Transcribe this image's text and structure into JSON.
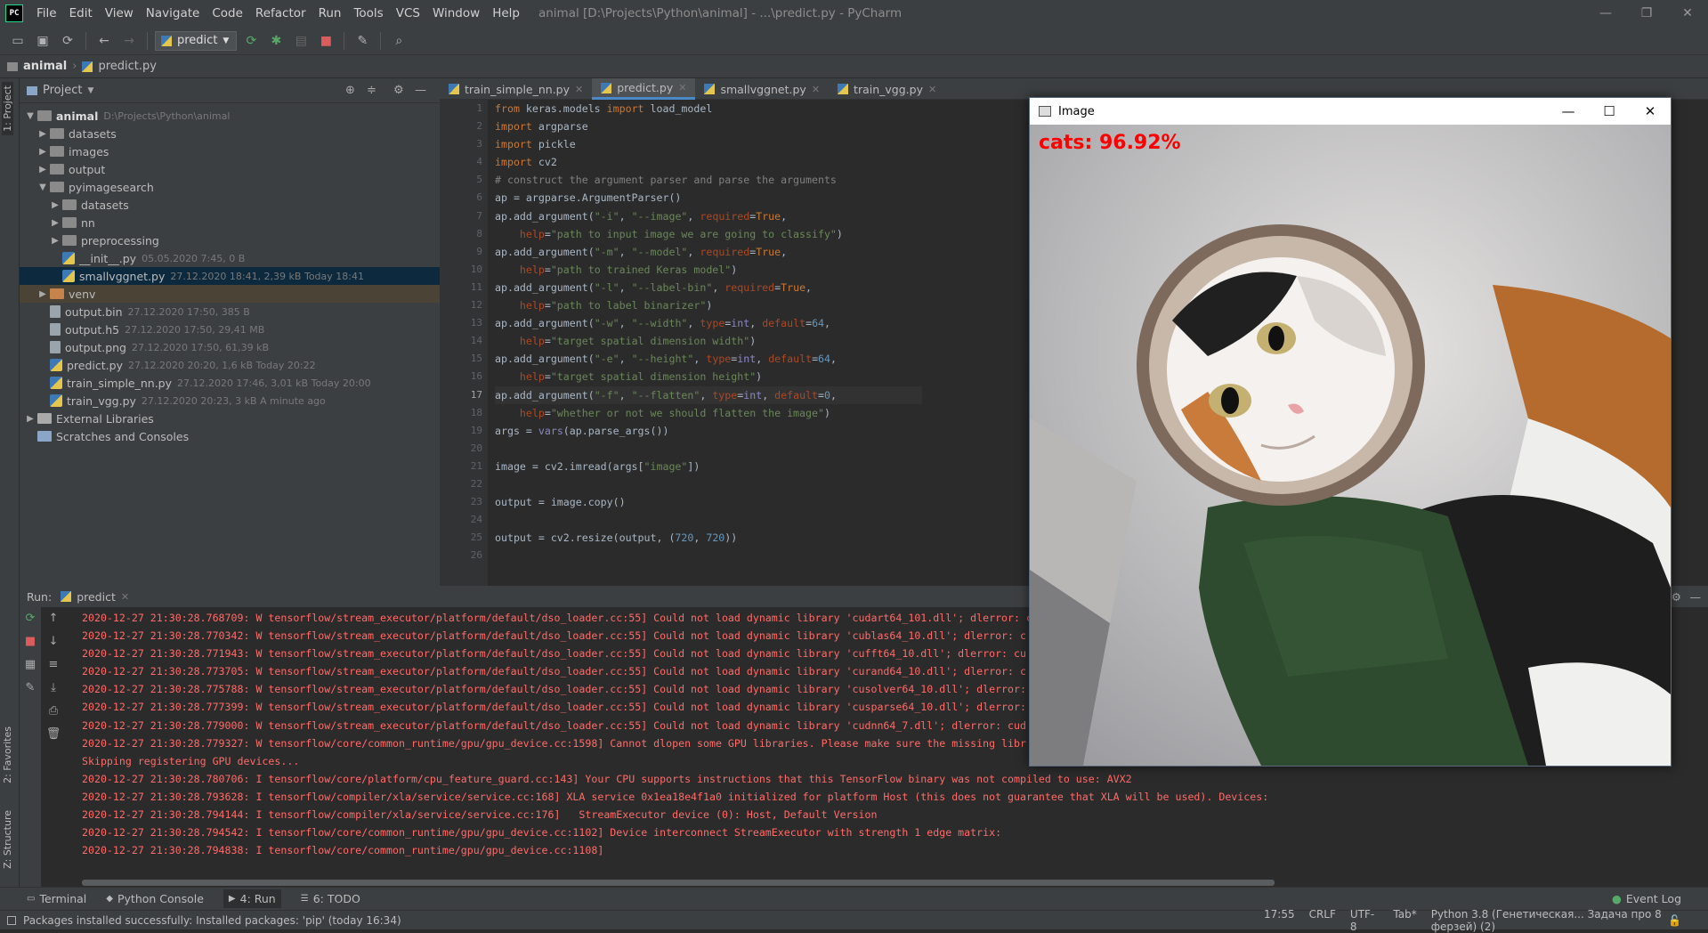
{
  "app": {
    "title": "animal [D:\\Projects\\Python\\animal] - ...\\predict.py - PyCharm",
    "menu": [
      "File",
      "Edit",
      "View",
      "Navigate",
      "Code",
      "Refactor",
      "Run",
      "Tools",
      "VCS",
      "Window",
      "Help"
    ]
  },
  "toolbar": {
    "run_config": "predict"
  },
  "breadcrumb": {
    "project": "animal",
    "file": "predict.py"
  },
  "left_strip": {
    "project": "1: Project",
    "favorites": "2: Favorites",
    "structure": "Z: Structure"
  },
  "project_panel": {
    "title": "Project",
    "tree": [
      {
        "indent": 0,
        "arrow": "▼",
        "icon": "folder",
        "name": "animal",
        "meta": "D:\\Projects\\Python\\animal",
        "bold": true
      },
      {
        "indent": 1,
        "arrow": "▶",
        "icon": "folder",
        "name": "datasets",
        "meta": ""
      },
      {
        "indent": 1,
        "arrow": "▶",
        "icon": "folder",
        "name": "images",
        "meta": ""
      },
      {
        "indent": 1,
        "arrow": "▶",
        "icon": "folder",
        "name": "output",
        "meta": ""
      },
      {
        "indent": 1,
        "arrow": "▼",
        "icon": "folder",
        "name": "pyimagesearch",
        "meta": ""
      },
      {
        "indent": 2,
        "arrow": "▶",
        "icon": "folder",
        "name": "datasets",
        "meta": ""
      },
      {
        "indent": 2,
        "arrow": "▶",
        "icon": "folder",
        "name": "nn",
        "meta": ""
      },
      {
        "indent": 2,
        "arrow": "▶",
        "icon": "folder",
        "name": "preprocessing",
        "meta": ""
      },
      {
        "indent": 2,
        "arrow": "",
        "icon": "py",
        "name": "__init__.py",
        "meta": "05.05.2020 7:45, 0 B"
      },
      {
        "indent": 2,
        "arrow": "",
        "icon": "py",
        "name": "smallvggnet.py",
        "meta": "27.12.2020 18:41, 2,39 kB Today 18:41",
        "selected": true
      },
      {
        "indent": 1,
        "arrow": "▶",
        "icon": "folder-orange",
        "name": "venv",
        "meta": "",
        "venv": true
      },
      {
        "indent": 1,
        "arrow": "",
        "icon": "file",
        "name": "output.bin",
        "meta": "27.12.2020 17:50, 385 B"
      },
      {
        "indent": 1,
        "arrow": "",
        "icon": "file",
        "name": "output.h5",
        "meta": "27.12.2020 17:50, 29,41 MB"
      },
      {
        "indent": 1,
        "arrow": "",
        "icon": "file",
        "name": "output.png",
        "meta": "27.12.2020 17:50, 61,39 kB"
      },
      {
        "indent": 1,
        "arrow": "",
        "icon": "py",
        "name": "predict.py",
        "meta": "27.12.2020 20:20, 1,6 kB Today 20:22"
      },
      {
        "indent": 1,
        "arrow": "",
        "icon": "py",
        "name": "train_simple_nn.py",
        "meta": "27.12.2020 17:46, 3,01 kB Today 20:00"
      },
      {
        "indent": 1,
        "arrow": "",
        "icon": "py",
        "name": "train_vgg.py",
        "meta": "27.12.2020 20:23, 3 kB A minute ago"
      },
      {
        "indent": 0,
        "arrow": "▶",
        "icon": "lib",
        "name": "External Libraries",
        "meta": ""
      },
      {
        "indent": 0,
        "arrow": "",
        "icon": "scratch",
        "name": "Scratches and Consoles",
        "meta": ""
      }
    ]
  },
  "editor": {
    "tabs": [
      {
        "label": "train_simple_nn.py",
        "active": false
      },
      {
        "label": "predict.py",
        "active": true
      },
      {
        "label": "smallvggnet.py",
        "active": false
      },
      {
        "label": "train_vgg.py",
        "active": false
      }
    ],
    "line_numbers": [
      "1",
      "2",
      "3",
      "4",
      "5",
      "6",
      "7",
      "8",
      "9",
      "10",
      "11",
      "12",
      "13",
      "14",
      "15",
      "16",
      "17",
      "18",
      "19",
      "20",
      "21",
      "22",
      "23",
      "24",
      "25",
      "26"
    ],
    "lines": [
      [
        [
          "kw",
          "from "
        ],
        [
          "",
          "keras.models "
        ],
        [
          "kw",
          "import "
        ],
        [
          "",
          "load_model"
        ]
      ],
      [
        [
          "kw",
          "import "
        ],
        [
          "",
          "argparse"
        ]
      ],
      [
        [
          "kw",
          "import "
        ],
        [
          "",
          "pickle"
        ]
      ],
      [
        [
          "kw",
          "import "
        ],
        [
          "",
          "cv2"
        ]
      ],
      [
        [
          "cm",
          "# construct the argument parser and parse the arguments"
        ]
      ],
      [
        [
          "",
          "ap = argparse.ArgumentParser()"
        ]
      ],
      [
        [
          "",
          "ap.add_argument("
        ],
        [
          "st",
          "\"-i\""
        ],
        [
          "",
          ", "
        ],
        [
          "st",
          "\"--image\""
        ],
        [
          "",
          ", "
        ],
        [
          "pa",
          "required"
        ],
        [
          "",
          "="
        ],
        [
          "kw",
          "True"
        ],
        [
          "",
          ","
        ]
      ],
      [
        [
          "",
          "    "
        ],
        [
          "pa",
          "help"
        ],
        [
          "",
          "="
        ],
        [
          "st",
          "\"path to input image we are going to classify\""
        ],
        [
          "",
          ")"
        ]
      ],
      [
        [
          "",
          "ap.add_argument("
        ],
        [
          "st",
          "\"-m\""
        ],
        [
          "",
          ", "
        ],
        [
          "st",
          "\"--model\""
        ],
        [
          "",
          ", "
        ],
        [
          "pa",
          "required"
        ],
        [
          "",
          "="
        ],
        [
          "kw",
          "True"
        ],
        [
          "",
          ","
        ]
      ],
      [
        [
          "",
          "    "
        ],
        [
          "pa",
          "help"
        ],
        [
          "",
          "="
        ],
        [
          "st",
          "\"path to trained Keras model\""
        ],
        [
          "",
          ")"
        ]
      ],
      [
        [
          "",
          "ap.add_argument("
        ],
        [
          "st",
          "\"-l\""
        ],
        [
          "",
          ", "
        ],
        [
          "st",
          "\"--label-bin\""
        ],
        [
          "",
          ", "
        ],
        [
          "pa",
          "required"
        ],
        [
          "",
          "="
        ],
        [
          "kw",
          "True"
        ],
        [
          "",
          ","
        ]
      ],
      [
        [
          "",
          "    "
        ],
        [
          "pa",
          "help"
        ],
        [
          "",
          "="
        ],
        [
          "st",
          "\"path to label binarizer\""
        ],
        [
          "",
          ")"
        ]
      ],
      [
        [
          "",
          "ap.add_argument("
        ],
        [
          "st",
          "\"-w\""
        ],
        [
          "",
          ", "
        ],
        [
          "st",
          "\"--width\""
        ],
        [
          "",
          ", "
        ],
        [
          "pa",
          "type"
        ],
        [
          "",
          "="
        ],
        [
          "bi",
          "int"
        ],
        [
          "",
          ", "
        ],
        [
          "pa",
          "default"
        ],
        [
          "",
          "="
        ],
        [
          "nu",
          "64"
        ],
        [
          "",
          ","
        ]
      ],
      [
        [
          "",
          "    "
        ],
        [
          "pa",
          "help"
        ],
        [
          "",
          "="
        ],
        [
          "st",
          "\"target spatial dimension width\""
        ],
        [
          "",
          ")"
        ]
      ],
      [
        [
          "",
          "ap.add_argument("
        ],
        [
          "st",
          "\"-e\""
        ],
        [
          "",
          ", "
        ],
        [
          "st",
          "\"--height\""
        ],
        [
          "",
          ", "
        ],
        [
          "pa",
          "type"
        ],
        [
          "",
          "="
        ],
        [
          "bi",
          "int"
        ],
        [
          "",
          ", "
        ],
        [
          "pa",
          "default"
        ],
        [
          "",
          "="
        ],
        [
          "nu",
          "64"
        ],
        [
          "",
          ","
        ]
      ],
      [
        [
          "",
          "    "
        ],
        [
          "pa",
          "help"
        ],
        [
          "",
          "="
        ],
        [
          "st",
          "\"target spatial dimension height\""
        ],
        [
          "",
          ")"
        ]
      ],
      [
        [
          "",
          "ap.add_argument("
        ],
        [
          "st",
          "\"-f\""
        ],
        [
          "",
          ", "
        ],
        [
          "st",
          "\"--flatten\""
        ],
        [
          "",
          ", "
        ],
        [
          "pa",
          "type"
        ],
        [
          "",
          "="
        ],
        [
          "bi",
          "int"
        ],
        [
          "",
          ", "
        ],
        [
          "pa",
          "default"
        ],
        [
          "",
          "="
        ],
        [
          "nu",
          "0"
        ],
        [
          "",
          ","
        ]
      ],
      [
        [
          "",
          "    "
        ],
        [
          "pa",
          "help"
        ],
        [
          "",
          "="
        ],
        [
          "st",
          "\"whether or not we should flatten the image\""
        ],
        [
          "",
          ")"
        ]
      ],
      [
        [
          "",
          "args = "
        ],
        [
          "bi",
          "vars"
        ],
        [
          "",
          "(ap.parse_args())"
        ]
      ],
      [
        [
          "",
          ""
        ]
      ],
      [
        [
          "",
          "image = cv2.imread(args["
        ],
        [
          "st",
          "\"image\""
        ],
        [
          "",
          "])"
        ]
      ],
      [
        [
          "",
          ""
        ]
      ],
      [
        [
          "",
          "output = image.copy()"
        ]
      ],
      [
        [
          "",
          ""
        ]
      ],
      [
        [
          "",
          "output = cv2.resize(output, ("
        ],
        [
          "nu",
          "720"
        ],
        [
          "",
          ", "
        ],
        [
          "nu",
          "720"
        ],
        [
          "",
          "))"
        ]
      ],
      [
        [
          "",
          ""
        ]
      ]
    ]
  },
  "run_panel": {
    "label": "Run:",
    "tab": "predict",
    "log": [
      "2020-12-27 21:30:28.768709: W tensorflow/stream_executor/platform/default/dso_loader.cc:55] Could not load dynamic library 'cudart64_101.dll'; dlerror: c",
      "2020-12-27 21:30:28.770342: W tensorflow/stream_executor/platform/default/dso_loader.cc:55] Could not load dynamic library 'cublas64_10.dll'; dlerror: c",
      "2020-12-27 21:30:28.771943: W tensorflow/stream_executor/platform/default/dso_loader.cc:55] Could not load dynamic library 'cufft64_10.dll'; dlerror: cu",
      "2020-12-27 21:30:28.773705: W tensorflow/stream_executor/platform/default/dso_loader.cc:55] Could not load dynamic library 'curand64_10.dll'; dlerror: c",
      "2020-12-27 21:30:28.775788: W tensorflow/stream_executor/platform/default/dso_loader.cc:55] Could not load dynamic library 'cusolver64_10.dll'; dlerror:",
      "2020-12-27 21:30:28.777399: W tensorflow/stream_executor/platform/default/dso_loader.cc:55] Could not load dynamic library 'cusparse64_10.dll'; dlerror:",
      "2020-12-27 21:30:28.779000: W tensorflow/stream_executor/platform/default/dso_loader.cc:55] Could not load dynamic library 'cudnn64_7.dll'; dlerror: cud",
      "2020-12-27 21:30:28.779327: W tensorflow/core/common_runtime/gpu/gpu_device.cc:1598] Cannot dlopen some GPU libraries. Please make sure the missing libr",
      "Skipping registering GPU devices...",
      "2020-12-27 21:30:28.780706: I tensorflow/core/platform/cpu_feature_guard.cc:143] Your CPU supports instructions that this TensorFlow binary was not compiled to use: AVX2",
      "2020-12-27 21:30:28.793628: I tensorflow/compiler/xla/service/service.cc:168] XLA service 0x1ea18e4f1a0 initialized for platform Host (this does not guarantee that XLA will be used). Devices:",
      "2020-12-27 21:30:28.794144: I tensorflow/compiler/xla/service/service.cc:176]   StreamExecutor device (0): Host, Default Version",
      "2020-12-27 21:30:28.794542: I tensorflow/core/common_runtime/gpu/gpu_device.cc:1102] Device interconnect StreamExecutor with strength 1 edge matrix:",
      "2020-12-27 21:30:28.794838: I tensorflow/core/common_runtime/gpu/gpu_device.cc:1108]"
    ]
  },
  "bottom_tabs": [
    {
      "label": "Terminal",
      "icon": "terminal-icon",
      "active": false
    },
    {
      "label": "Python Console",
      "icon": "python-icon",
      "active": false
    },
    {
      "label": "4: Run",
      "icon": "run-icon",
      "active": true
    },
    {
      "label": "6: TODO",
      "icon": "todo-icon",
      "active": false
    }
  ],
  "event_log": "Event Log",
  "status": {
    "message": "Packages installed successfully: Installed packages: 'pip' (today 16:34)",
    "position": "17:55",
    "line_sep": "CRLF",
    "encoding": "UTF-8",
    "indent": "Tab*",
    "interpreter": "Python 3.8 (Генетическая... Задача про 8 ферзей) (2)"
  },
  "image_window": {
    "title": "Image",
    "prediction": "cats: 96.92%",
    "prediction_color": "#ff0000"
  }
}
